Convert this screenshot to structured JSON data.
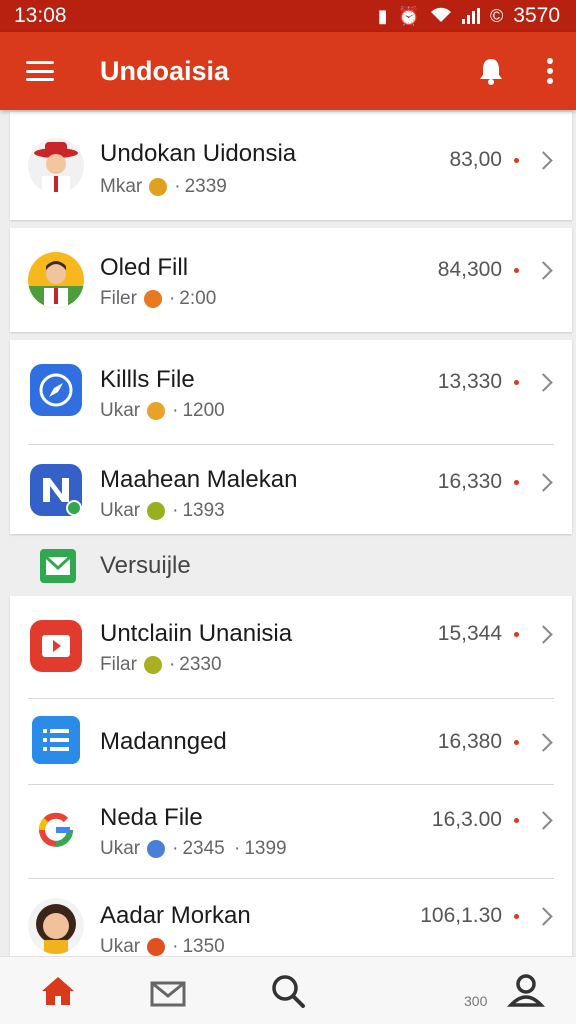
{
  "status_bar": {
    "time": "13:08",
    "right_text": "3570"
  },
  "app_bar": {
    "title": "Undoaisia"
  },
  "list": [
    {
      "title": "Undokan Uidonsia",
      "sub_prefix": "Mkar",
      "sub_value": "2339",
      "value": "83,00",
      "icon": "person-hat-avatar",
      "mini_color": "#e0a020"
    },
    {
      "title": "Oled Fill",
      "sub_prefix": "Filer",
      "sub_value": "2:00",
      "value": "84,300",
      "icon": "person-avatar",
      "mini_color": "#e8791e"
    },
    {
      "title": "Killls File",
      "sub_prefix": "Ukar",
      "sub_value": "1200",
      "value": "13,330",
      "icon": "compass-app-icon",
      "mini_color": "#e8a22a"
    },
    {
      "title": "Maahean Malekan",
      "sub_prefix": "Ukar",
      "sub_value": "1393",
      "value": "16,330",
      "icon": "n-app-icon",
      "mini_color": "#98b020"
    },
    {
      "title": "Untclaiin Unanisia",
      "sub_prefix": "Filar",
      "sub_value": "2330",
      "value": "15,344",
      "icon": "video-app-icon",
      "mini_color": "#a8b020"
    },
    {
      "title": "Madannged",
      "sub_prefix": "",
      "sub_value": "",
      "value": "16,380",
      "icon": "list-app-icon",
      "mini_color": ""
    },
    {
      "title": "Neda File",
      "sub_prefix": "Ukar",
      "sub_value": "2345",
      "sub_extra": "1399",
      "value": "16,3.00",
      "icon": "google-icon",
      "mini_color": "#4a7fd8"
    },
    {
      "title": "Aadar Morkan",
      "sub_prefix": "Ukar",
      "sub_value": "1350",
      "value": "106,1.30",
      "icon": "woman-avatar",
      "mini_color": "#e05020"
    }
  ],
  "section": {
    "label": "Versuijle"
  },
  "bottom_nav": {
    "label": "300"
  },
  "colors": {
    "primary": "#d93a1c",
    "status_bar": "#b8200f",
    "accent_dot": "#d93a1c"
  }
}
